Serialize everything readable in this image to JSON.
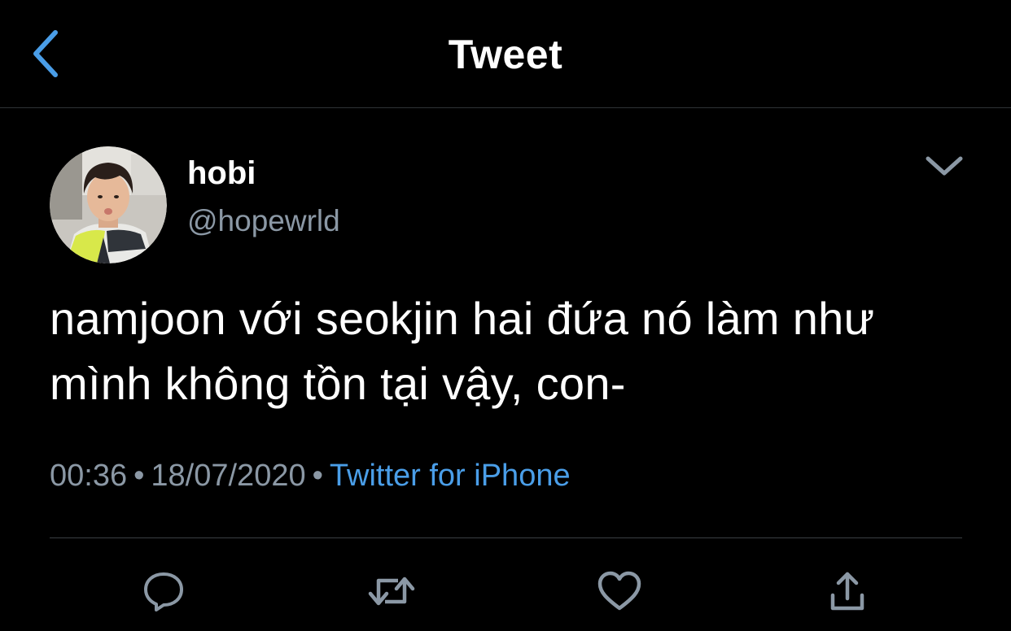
{
  "header": {
    "title": "Tweet",
    "back_icon": "chevron-left-icon"
  },
  "author": {
    "display_name": "hobi",
    "handle": "@hopewrld",
    "avatar_icon": "profile-photo"
  },
  "tweet": {
    "text": "namjoon với seokjin hai đứa nó làm như mình không tồn tại vậy, con-",
    "time": "00:36",
    "date": "18/07/2020",
    "separator": "•",
    "source": "Twitter for iPhone"
  },
  "actions": {
    "reply_icon": "reply-bubble-icon",
    "retweet_icon": "retweet-icon",
    "like_icon": "heart-icon",
    "share_icon": "share-icon",
    "more_icon": "chevron-down-icon"
  },
  "colors": {
    "background": "#000000",
    "text": "#ffffff",
    "secondary": "#8b98a5",
    "accent": "#4a9ee8",
    "divider": "#3a3f44"
  }
}
